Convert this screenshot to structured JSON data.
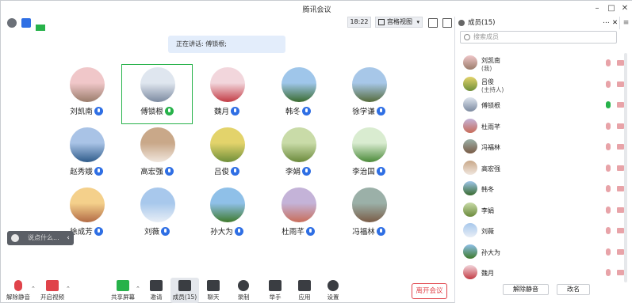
{
  "window": {
    "title": "腾讯会议"
  },
  "toolbar": {
    "time": "18:22",
    "view_label": "宫格视图"
  },
  "speaker_banner": "正在讲话: 傅锁根;",
  "participants": [
    {
      "name": "刘凯南",
      "colors": [
        "#f0c7c9",
        "#9a7c6b"
      ]
    },
    {
      "name": "傅锁根",
      "colors": [
        "#dfe6ef",
        "#7c8aa0"
      ]
    },
    {
      "name": "魏月",
      "colors": [
        "#f2d6dc",
        "#c23b44"
      ]
    },
    {
      "name": "韩冬",
      "colors": [
        "#9fc6ea",
        "#3a6b2f"
      ]
    },
    {
      "name": "徐学谦",
      "colors": [
        "#a7c7e8",
        "#556b3b"
      ]
    },
    {
      "name": "赵秀娥",
      "colors": [
        "#a9c3e6",
        "#2f5c8a"
      ]
    },
    {
      "name": "高宏强",
      "colors": [
        "#c9a889",
        "#f0e6dd"
      ]
    },
    {
      "name": "吕俊",
      "colors": [
        "#e3d36b",
        "#6f8f3a"
      ]
    },
    {
      "name": "李娟",
      "colors": [
        "#c9dba8",
        "#6b8a3c"
      ]
    },
    {
      "name": "李治国",
      "colors": [
        "#d9ecd0",
        "#4b8a3a"
      ]
    },
    {
      "name": "徐成芳",
      "colors": [
        "#f4d08b",
        "#b26b45"
      ]
    },
    {
      "name": "刘薇",
      "colors": [
        "#a8c8ec",
        "#e8eef6"
      ]
    },
    {
      "name": "孙大为",
      "colors": [
        "#8fc0e8",
        "#3f7a2d"
      ]
    },
    {
      "name": "杜雨芊",
      "colors": [
        "#c4b3d8",
        "#c86d5a"
      ]
    },
    {
      "name": "冯福林",
      "colors": [
        "#9bb0a8",
        "#7a5c47"
      ]
    }
  ],
  "chat_placeholder": "说点什么...",
  "bottom": {
    "mute": "解除静音",
    "video": "开启视频",
    "share": "共享屏幕",
    "invite": "邀请",
    "members": "成员(15)",
    "chat": "聊天",
    "record": "录制",
    "raise": "举手",
    "apps": "应用",
    "settings": "设置",
    "leave": "离开会议"
  },
  "panel": {
    "title": "成员(15)",
    "search_placeholder": "搜索成员",
    "members": [
      {
        "name": "刘凯南",
        "sub": "(我)",
        "mic": "muted",
        "colors": [
          "#f0c7c9",
          "#9a7c6b"
        ]
      },
      {
        "name": "吕俊",
        "sub": "(主持人)",
        "mic": "muted",
        "colors": [
          "#e3d36b",
          "#6f8f3a"
        ]
      },
      {
        "name": "傅锁根",
        "sub": "",
        "mic": "on",
        "colors": [
          "#dfe6ef",
          "#7c8aa0"
        ]
      },
      {
        "name": "杜雨芊",
        "sub": "",
        "mic": "muted",
        "colors": [
          "#c4b3d8",
          "#c86d5a"
        ]
      },
      {
        "name": "冯福林",
        "sub": "",
        "mic": "muted",
        "colors": [
          "#9bb0a8",
          "#7a5c47"
        ]
      },
      {
        "name": "高宏强",
        "sub": "",
        "mic": "muted",
        "colors": [
          "#c9a889",
          "#f0e6dd"
        ]
      },
      {
        "name": "韩冬",
        "sub": "",
        "mic": "muted",
        "colors": [
          "#9fc6ea",
          "#3a6b2f"
        ]
      },
      {
        "name": "李娟",
        "sub": "",
        "mic": "muted",
        "colors": [
          "#c9dba8",
          "#6b8a3c"
        ]
      },
      {
        "name": "刘薇",
        "sub": "",
        "mic": "muted",
        "colors": [
          "#a8c8ec",
          "#e8eef6"
        ]
      },
      {
        "name": "孙大为",
        "sub": "",
        "mic": "muted",
        "colors": [
          "#8fc0e8",
          "#3f7a2d"
        ]
      },
      {
        "name": "魏月",
        "sub": "",
        "mic": "muted",
        "colors": [
          "#f2d6dc",
          "#c23b44"
        ]
      }
    ],
    "mute_all": "解除静音",
    "rename": "改名"
  },
  "colors": {
    "accent": "#2f6fe4",
    "active_speaker": "#27b24a",
    "leave": "#e0434a"
  }
}
